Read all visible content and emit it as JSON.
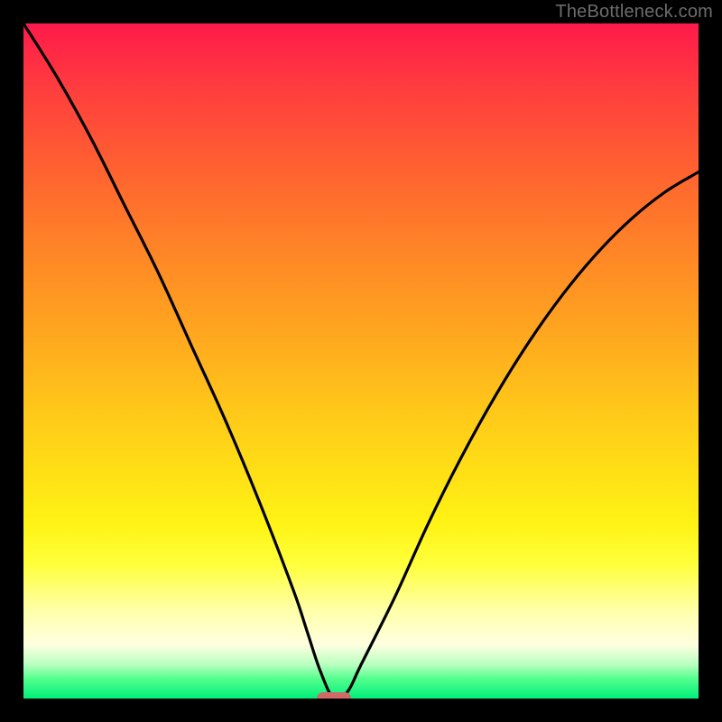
{
  "watermark": "TheBottleneck.com",
  "colors": {
    "frame": "#000000",
    "curve": "#000000",
    "marker": "#cf6a66",
    "watermark": "#6d6d6d"
  },
  "chart_data": {
    "type": "line",
    "title": "",
    "xlabel": "",
    "ylabel": "",
    "xlim": [
      0,
      100
    ],
    "ylim": [
      0,
      100
    ],
    "series": [
      {
        "name": "bottleneck-curve",
        "x": [
          0,
          5,
          10,
          15,
          20,
          25,
          30,
          35,
          40,
          42,
          44,
          46,
          48,
          50,
          55,
          60,
          65,
          70,
          75,
          80,
          85,
          90,
          95,
          100
        ],
        "y": [
          100,
          92,
          83,
          73,
          63,
          52,
          41,
          29,
          16,
          10,
          4,
          0,
          1,
          5,
          15,
          26,
          36,
          45,
          53,
          60,
          66,
          71,
          75,
          78
        ]
      }
    ],
    "marker": {
      "x": 46,
      "y": 0,
      "width_pct": 5
    }
  }
}
